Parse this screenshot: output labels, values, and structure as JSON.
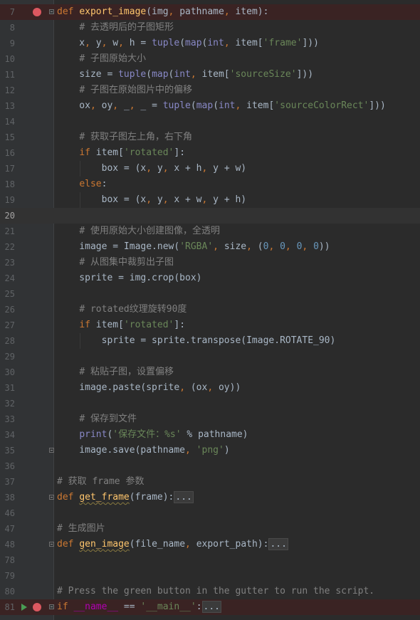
{
  "lines": [
    {
      "n": "7",
      "state": "bp",
      "fold": true,
      "tokens": [
        [
          "kw",
          "def "
        ],
        [
          "fn",
          "export_image"
        ],
        [
          "d",
          "(img"
        ],
        [
          "kw",
          ", "
        ],
        [
          "d",
          "pathname"
        ],
        [
          "kw",
          ", "
        ],
        [
          "d",
          "item):"
        ]
      ]
    },
    {
      "n": "8",
      "tokens": [
        [
          "d",
          "    "
        ],
        [
          "cm",
          "# 去透明后的子图矩形"
        ]
      ]
    },
    {
      "n": "9",
      "tokens": [
        [
          "d",
          "    x"
        ],
        [
          "kw",
          ", "
        ],
        [
          "d",
          "y"
        ],
        [
          "kw",
          ", "
        ],
        [
          "d",
          "w"
        ],
        [
          "kw",
          ", "
        ],
        [
          "d",
          "h = "
        ],
        [
          "bi",
          "tuple"
        ],
        [
          "d",
          "("
        ],
        [
          "bi",
          "map"
        ],
        [
          "d",
          "("
        ],
        [
          "bi",
          "int"
        ],
        [
          "kw",
          ", "
        ],
        [
          "d",
          "item["
        ],
        [
          "str",
          "'frame'"
        ],
        [
          "d",
          "]))"
        ]
      ]
    },
    {
      "n": "10",
      "tokens": [
        [
          "d",
          "    "
        ],
        [
          "cm",
          "# 子图原始大小"
        ]
      ]
    },
    {
      "n": "11",
      "tokens": [
        [
          "d",
          "    size = "
        ],
        [
          "bi",
          "tuple"
        ],
        [
          "d",
          "("
        ],
        [
          "bi",
          "map"
        ],
        [
          "d",
          "("
        ],
        [
          "bi",
          "int"
        ],
        [
          "kw",
          ", "
        ],
        [
          "d",
          "item["
        ],
        [
          "str",
          "'sourceSize'"
        ],
        [
          "d",
          "]))"
        ]
      ]
    },
    {
      "n": "12",
      "tokens": [
        [
          "d",
          "    "
        ],
        [
          "cm",
          "# 子图在原始图片中的偏移"
        ]
      ]
    },
    {
      "n": "13",
      "tokens": [
        [
          "d",
          "    ox"
        ],
        [
          "kw",
          ", "
        ],
        [
          "d",
          "oy"
        ],
        [
          "kw",
          ", "
        ],
        [
          "d",
          "_"
        ],
        [
          "kw",
          ", "
        ],
        [
          "d",
          "_ = "
        ],
        [
          "bi",
          "tuple"
        ],
        [
          "d",
          "("
        ],
        [
          "bi",
          "map"
        ],
        [
          "d",
          "("
        ],
        [
          "bi",
          "int"
        ],
        [
          "kw",
          ", "
        ],
        [
          "d",
          "item["
        ],
        [
          "str",
          "'sourceColorRect'"
        ],
        [
          "d",
          "]))"
        ]
      ]
    },
    {
      "n": "14",
      "tokens": []
    },
    {
      "n": "15",
      "tokens": [
        [
          "d",
          "    "
        ],
        [
          "cm",
          "# 获取子图左上角，右下角"
        ]
      ]
    },
    {
      "n": "16",
      "tokens": [
        [
          "d",
          "    "
        ],
        [
          "kw",
          "if "
        ],
        [
          "d",
          "item["
        ],
        [
          "str",
          "'rotated'"
        ],
        [
          "d",
          "]:"
        ]
      ]
    },
    {
      "n": "17",
      "tokens": [
        [
          "d",
          "        box = (x"
        ],
        [
          "kw",
          ", "
        ],
        [
          "d",
          "y"
        ],
        [
          "kw",
          ", "
        ],
        [
          "d",
          "x + h"
        ],
        [
          "kw",
          ", "
        ],
        [
          "d",
          "y + w)"
        ]
      ]
    },
    {
      "n": "18",
      "tokens": [
        [
          "d",
          "    "
        ],
        [
          "kw",
          "else"
        ],
        [
          "d",
          ":"
        ]
      ]
    },
    {
      "n": "19",
      "tokens": [
        [
          "d",
          "        box = (x"
        ],
        [
          "kw",
          ", "
        ],
        [
          "d",
          "y"
        ],
        [
          "kw",
          ", "
        ],
        [
          "d",
          "x + w"
        ],
        [
          "kw",
          ", "
        ],
        [
          "d",
          "y + h)"
        ]
      ]
    },
    {
      "n": "20",
      "state": "current",
      "tokens": []
    },
    {
      "n": "21",
      "tokens": [
        [
          "d",
          "    "
        ],
        [
          "cm",
          "# 使用原始大小创建图像，全透明"
        ]
      ]
    },
    {
      "n": "22",
      "tokens": [
        [
          "d",
          "    image = Image.new("
        ],
        [
          "str",
          "'RGBA'"
        ],
        [
          "kw",
          ", "
        ],
        [
          "d",
          "size"
        ],
        [
          "kw",
          ", "
        ],
        [
          "d",
          "("
        ],
        [
          "nm",
          "0"
        ],
        [
          "kw",
          ", "
        ],
        [
          "nm",
          "0"
        ],
        [
          "kw",
          ", "
        ],
        [
          "nm",
          "0"
        ],
        [
          "kw",
          ", "
        ],
        [
          "nm",
          "0"
        ],
        [
          "d",
          "))"
        ]
      ]
    },
    {
      "n": "23",
      "tokens": [
        [
          "d",
          "    "
        ],
        [
          "cm",
          "# 从图集中裁剪出子图"
        ]
      ]
    },
    {
      "n": "24",
      "tokens": [
        [
          "d",
          "    sprite = img.crop(box)"
        ]
      ]
    },
    {
      "n": "25",
      "tokens": []
    },
    {
      "n": "26",
      "tokens": [
        [
          "d",
          "    "
        ],
        [
          "cm",
          "# rotated纹理旋转90度"
        ]
      ]
    },
    {
      "n": "27",
      "tokens": [
        [
          "d",
          "    "
        ],
        [
          "kw",
          "if "
        ],
        [
          "d",
          "item["
        ],
        [
          "str",
          "'rotated'"
        ],
        [
          "d",
          "]:"
        ]
      ]
    },
    {
      "n": "28",
      "tokens": [
        [
          "d",
          "        sprite = sprite.transpose(Image.ROTATE_90)"
        ]
      ]
    },
    {
      "n": "29",
      "tokens": []
    },
    {
      "n": "30",
      "tokens": [
        [
          "d",
          "    "
        ],
        [
          "cm",
          "# 粘贴子图，设置偏移"
        ]
      ]
    },
    {
      "n": "31",
      "tokens": [
        [
          "d",
          "    image.paste(sprite"
        ],
        [
          "kw",
          ", "
        ],
        [
          "d",
          "(ox"
        ],
        [
          "kw",
          ", "
        ],
        [
          "d",
          "oy))"
        ]
      ]
    },
    {
      "n": "32",
      "tokens": []
    },
    {
      "n": "33",
      "tokens": [
        [
          "d",
          "    "
        ],
        [
          "cm",
          "# 保存到文件"
        ]
      ]
    },
    {
      "n": "34",
      "tokens": [
        [
          "d",
          "    "
        ],
        [
          "bi",
          "print"
        ],
        [
          "d",
          "("
        ],
        [
          "str",
          "'保存文件：%s'"
        ],
        [
          "d",
          " % pathname)"
        ]
      ]
    },
    {
      "n": "35",
      "fold": true,
      "tokens": [
        [
          "d",
          "    image.save(pathname"
        ],
        [
          "kw",
          ", "
        ],
        [
          "str",
          "'png'"
        ],
        [
          "d",
          ")"
        ]
      ]
    },
    {
      "n": "36",
      "tokens": []
    },
    {
      "n": "37",
      "tokens": [
        [
          "cm",
          "# 获取 frame 参数"
        ]
      ]
    },
    {
      "n": "38",
      "fold": true,
      "tokens": [
        [
          "kw",
          "def "
        ],
        [
          "fn",
          "get_frame"
        ],
        [
          "d",
          "(frame):"
        ],
        [
          "fold",
          "..."
        ]
      ]
    },
    {
      "n": "46",
      "tokens": []
    },
    {
      "n": "47",
      "tokens": [
        [
          "cm",
          "# 生成图片"
        ]
      ]
    },
    {
      "n": "48",
      "fold": true,
      "tokens": [
        [
          "kw",
          "def "
        ],
        [
          "fn",
          "gen_image"
        ],
        [
          "d",
          "(file_name"
        ],
        [
          "kw",
          ", "
        ],
        [
          "d",
          "export_path):"
        ],
        [
          "fold",
          "..."
        ]
      ]
    },
    {
      "n": "78",
      "tokens": []
    },
    {
      "n": "79",
      "tokens": []
    },
    {
      "n": "80",
      "tokens": [
        [
          "cm",
          "# Press the green button in the gutter to run the script."
        ]
      ]
    },
    {
      "n": "81",
      "state": "bp",
      "run": true,
      "fold": true,
      "tokens": [
        [
          "kw",
          "if "
        ],
        [
          "dunder",
          "__name__"
        ],
        [
          "d",
          " == "
        ],
        [
          "str",
          "'__main__'"
        ],
        [
          "d",
          ":"
        ],
        [
          "fold",
          "..."
        ]
      ]
    }
  ]
}
